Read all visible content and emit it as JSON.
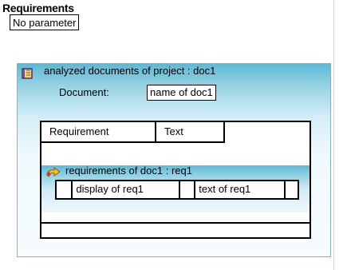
{
  "section_title": "Requirements",
  "parameter_label": "No parameter",
  "documents": {
    "label": "analyzed documents of project : doc1",
    "document_label": "Document:",
    "document_value": "name of doc1",
    "table": {
      "headers": [
        "Requirement",
        "Text"
      ],
      "requirement_label": "requirements of doc1 : req1",
      "row": {
        "display": "display of req1",
        "text": "text of req1"
      }
    }
  },
  "colors": {
    "panel_gradient_top": "#5cb9d4",
    "panel_gradient_bottom": "#f7fcfe"
  },
  "icons": [
    "document-book-icon",
    "requirement-arrow-icon"
  ]
}
